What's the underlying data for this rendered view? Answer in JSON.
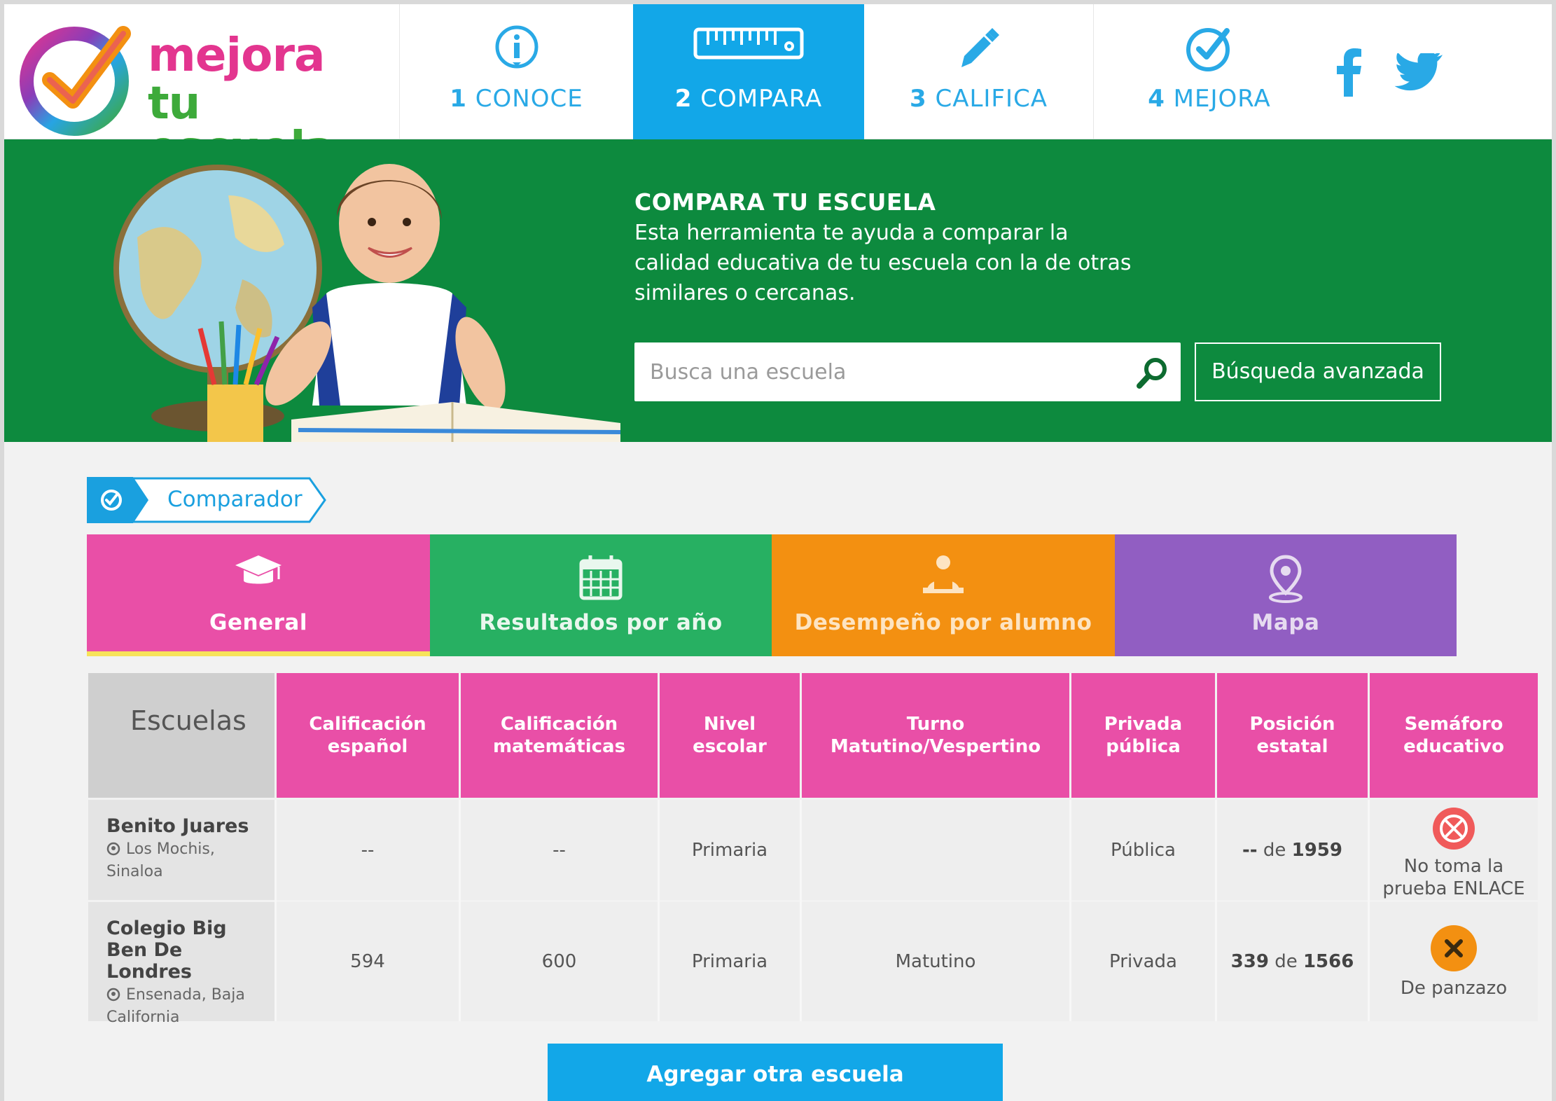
{
  "brand": {
    "line1": "mejora",
    "line2": "tu escuela"
  },
  "nav": [
    {
      "num": "1",
      "label": "CONOCE",
      "icon": "info-icon"
    },
    {
      "num": "2",
      "label": "COMPARA",
      "icon": "ruler-icon",
      "active": true
    },
    {
      "num": "3",
      "label": "CALIFICA",
      "icon": "pen-icon"
    },
    {
      "num": "4",
      "label": "MEJORA",
      "icon": "check-circle-icon"
    }
  ],
  "social": [
    "facebook-icon",
    "twitter-icon"
  ],
  "hero": {
    "title": "COMPARA TU ESCUELA",
    "text": "Esta herramienta te ayuda a comparar la calidad educativa de tu escuela con la de otras similares o cercanas.",
    "search_placeholder": "Busca una escuela",
    "advanced_label": "Búsqueda avanzada"
  },
  "breadcrumb": {
    "label": "Comparador"
  },
  "tiles": [
    {
      "label": "General",
      "icon": "graduation-cap-icon",
      "color": "#e94fa7"
    },
    {
      "label": "Resultados por año",
      "icon": "calendar-icon",
      "color": "#27b062"
    },
    {
      "label": "Desempeño por alumno",
      "icon": "student-icon",
      "color": "#f39011"
    },
    {
      "label": "Mapa",
      "icon": "map-pin-icon",
      "color": "#915ec2"
    }
  ],
  "table": {
    "headers": [
      "Escuelas",
      "Calificación español",
      "Calificación matemáticas",
      "Nivel escolar",
      "Turno Matutino/Vespertino",
      "Privada pública",
      "Posición estatal",
      "Semáforo educativo"
    ],
    "rows": [
      {
        "name": "Benito Juares",
        "location": "Los Mochis, Sinaloa",
        "espanol": "--",
        "matematicas": "--",
        "nivel": "Primaria",
        "turno": "",
        "tipo": "Pública",
        "pos_rank": "--",
        "pos_de": "de",
        "pos_total": "1959",
        "semaforo": "No toma la prueba ENLACE",
        "semaforo_icon": "no-test-icon"
      },
      {
        "name": "Colegio Big Ben De Londres",
        "location": "Ensenada, Baja California",
        "espanol": "594",
        "matematicas": "600",
        "nivel": "Primaria",
        "turno": "Matutino",
        "tipo": "Privada",
        "pos_rank": "339",
        "pos_de": "de",
        "pos_total": "1566",
        "semaforo": "De panzazo",
        "semaforo_icon": "x-circle-icon"
      }
    ]
  },
  "add_button": "Agregar otra escuela",
  "colors": {
    "pink": "#e94fa7",
    "green": "#0d8a3e",
    "blue": "#12a7e8",
    "orange": "#f39011",
    "purple": "#915ec2"
  }
}
